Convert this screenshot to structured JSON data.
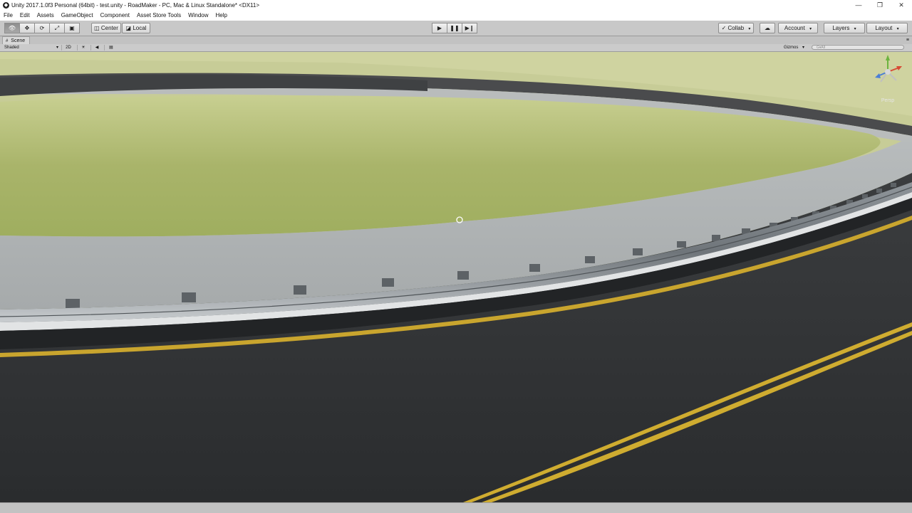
{
  "window": {
    "title": "Unity 2017.1.0f3 Personal (64bit) - test.unity - RoadMaker - PC, Mac & Linux Standalone* <DX11>",
    "app_icon": "unity-logo-icon",
    "controls": {
      "minimize": "—",
      "restore": "❐",
      "close": "✕"
    }
  },
  "menu": {
    "items": [
      "File",
      "Edit",
      "Assets",
      "GameObject",
      "Component",
      "Asset Store Tools",
      "Window",
      "Help"
    ]
  },
  "toolbar": {
    "tools": [
      {
        "icon": "hand-icon",
        "glyph": "👁"
      },
      {
        "icon": "move-icon",
        "glyph": "✥"
      },
      {
        "icon": "rotate-icon",
        "glyph": "⟳"
      },
      {
        "icon": "scale-icon",
        "glyph": "⤢"
      },
      {
        "icon": "rect-tool-icon",
        "glyph": "▣"
      }
    ],
    "pivot": "Center",
    "pivot_icon": "◫",
    "space": "Local",
    "space_icon": "◪",
    "play": "▶",
    "pause": "❚❚",
    "step": "▶❙",
    "collab": "Collab",
    "collab_icon": "✓",
    "cloud_icon": "☁",
    "account": "Account",
    "layers": "Layers",
    "layout": "Layout",
    "caret": "▾"
  },
  "scene_tab": {
    "label": "Scene",
    "icon": "#",
    "menu_icon": "≡"
  },
  "scene_toolbar": {
    "shading": "Shaded",
    "mode_2d": "2D",
    "lighting_icon": "☀",
    "audio_icon": "◀",
    "effects_icon": "▤",
    "gizmos": "Gizmos",
    "search_placeholder": "G▾All"
  },
  "orientation_gizmo": {
    "label": "Persp"
  },
  "colors": {
    "grass": "#a7b464",
    "asphalt": "#2f3133",
    "shoulder": "#b3b6b7",
    "road_line": "#d7b32c",
    "guardrail": "#9aa0a5"
  }
}
